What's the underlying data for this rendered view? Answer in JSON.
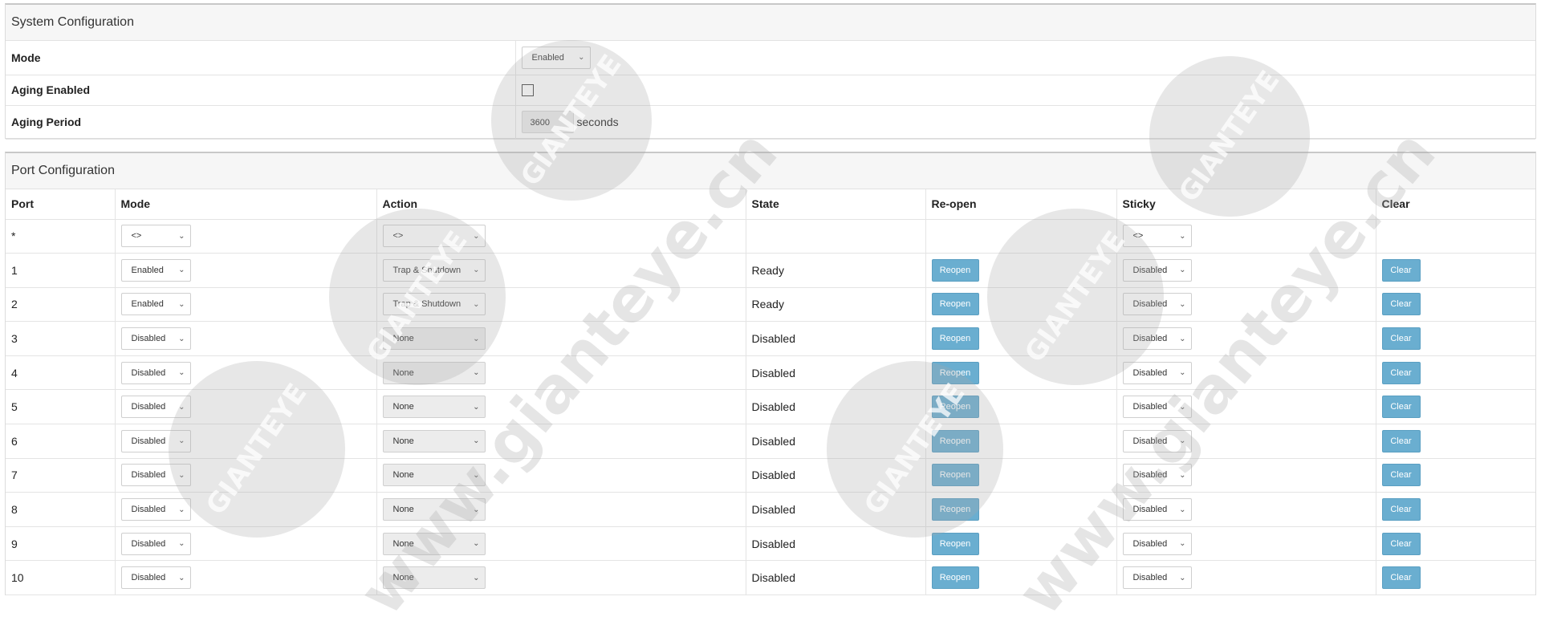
{
  "system": {
    "title": "System Configuration",
    "rows": [
      {
        "label": "Mode",
        "value": "Enabled"
      },
      {
        "label": "Aging Enabled",
        "checked": false
      },
      {
        "label": "Aging Period",
        "value": "3600",
        "unit": "seconds"
      }
    ]
  },
  "port": {
    "title": "Port Configuration",
    "headers": [
      "Port",
      "Mode",
      "Action",
      "State",
      "Re-open",
      "Sticky",
      "Clear"
    ],
    "all_row": {
      "port": "*",
      "mode": "<>",
      "action": "<>",
      "sticky": "<>"
    },
    "rows": [
      {
        "port": "1",
        "mode": "Enabled",
        "action": "Trap & Shutdown",
        "action_disabled": false,
        "state": "Ready",
        "reopen": "Reopen",
        "sticky": "Disabled",
        "clear": "Clear"
      },
      {
        "port": "2",
        "mode": "Enabled",
        "action": "Trap & Shutdown",
        "action_disabled": false,
        "state": "Ready",
        "reopen": "Reopen",
        "sticky": "Disabled",
        "clear": "Clear"
      },
      {
        "port": "3",
        "mode": "Disabled",
        "action": "None",
        "action_disabled": true,
        "state": "Disabled",
        "reopen": "Reopen",
        "sticky": "Disabled",
        "clear": "Clear"
      },
      {
        "port": "4",
        "mode": "Disabled",
        "action": "None",
        "action_disabled": true,
        "state": "Disabled",
        "reopen": "Reopen",
        "sticky": "Disabled",
        "clear": "Clear"
      },
      {
        "port": "5",
        "mode": "Disabled",
        "action": "None",
        "action_disabled": true,
        "state": "Disabled",
        "reopen": "Reopen",
        "sticky": "Disabled",
        "clear": "Clear"
      },
      {
        "port": "6",
        "mode": "Disabled",
        "action": "None",
        "action_disabled": true,
        "state": "Disabled",
        "reopen": "Reopen",
        "sticky": "Disabled",
        "clear": "Clear"
      },
      {
        "port": "7",
        "mode": "Disabled",
        "action": "None",
        "action_disabled": true,
        "state": "Disabled",
        "reopen": "Reopen",
        "sticky": "Disabled",
        "clear": "Clear"
      },
      {
        "port": "8",
        "mode": "Disabled",
        "action": "None",
        "action_disabled": true,
        "state": "Disabled",
        "reopen": "Reopen",
        "sticky": "Disabled",
        "clear": "Clear"
      },
      {
        "port": "9",
        "mode": "Disabled",
        "action": "None",
        "action_disabled": true,
        "state": "Disabled",
        "reopen": "Reopen",
        "sticky": "Disabled",
        "clear": "Clear"
      },
      {
        "port": "10",
        "mode": "Disabled",
        "action": "None",
        "action_disabled": true,
        "state": "Disabled",
        "reopen": "Reopen",
        "sticky": "Disabled",
        "clear": "Clear"
      }
    ]
  },
  "watermark": {
    "logo_text": "GIANTEYE",
    "url_text": "www.gianteye.cn"
  }
}
